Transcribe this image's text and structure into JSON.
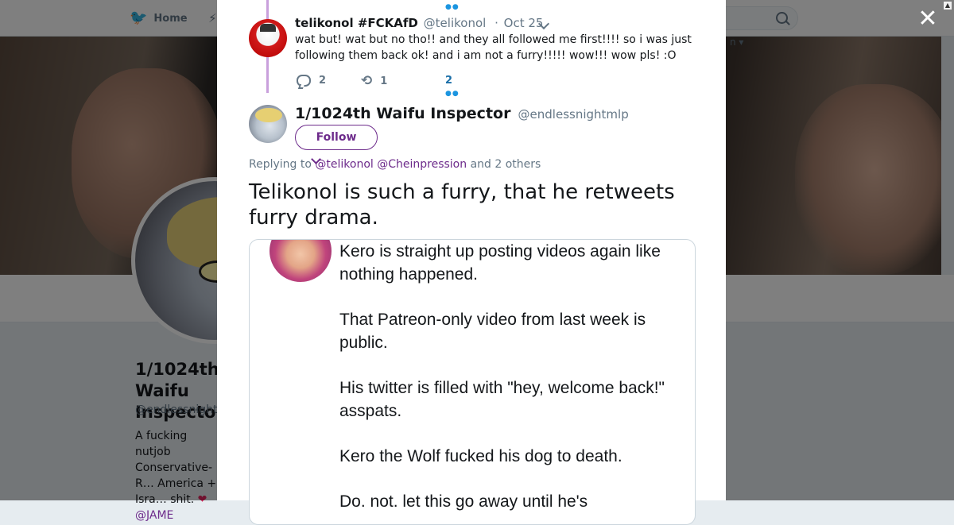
{
  "background": {
    "nav_home": "Home",
    "right_link": "n ▾",
    "profile": {
      "name": "1/1024th Waifu Inspector",
      "handle": "@endlessnightmlp",
      "bio": "A fucking nutjob Conservative-R… America + Isra… shit.",
      "bio_mention": "@JAME"
    }
  },
  "icons": {
    "bird": "twitter-bird-icon",
    "close": "close-icon",
    "search": "search-icon",
    "reply": "reply-icon",
    "retweet": "retweet-icon"
  },
  "colors": {
    "accent": "#6d2b8b",
    "thread_line": "#c9a0dc",
    "heart": "#e0245e"
  },
  "reply_tweet": {
    "name": "telikonol #FCKAfD",
    "handle": "@telikonol",
    "date": "Oct 25",
    "text": "wat but! wat but no tho!! and they all followed me first!!!! so i was just following them back ok! and i am not a furry!!!!! wow!!! wow pls! :O",
    "reply_count": "2",
    "retweet_count": "1",
    "like_count": "2"
  },
  "main_tweet": {
    "name": "1/1024th Waifu Inspector",
    "handle": "@endlessnightmlp",
    "follow_label": "Follow",
    "replying_prefix": "Replying to",
    "replying_mentions": "@telikonol @Cheinpression",
    "replying_suffix": "and 2 others",
    "text": "Telikonol is such a furry, that he retweets furry drama.",
    "media": {
      "paragraphs": [
        "Kero is straight up posting videos again like nothing happened.",
        "That Patreon-only video from last week is public.",
        "His twitter is filled with \"hey, welcome back!\" asspats.",
        "Kero the Wolf fucked his dog to death.",
        "Do. not. let this go away until he's"
      ]
    }
  }
}
